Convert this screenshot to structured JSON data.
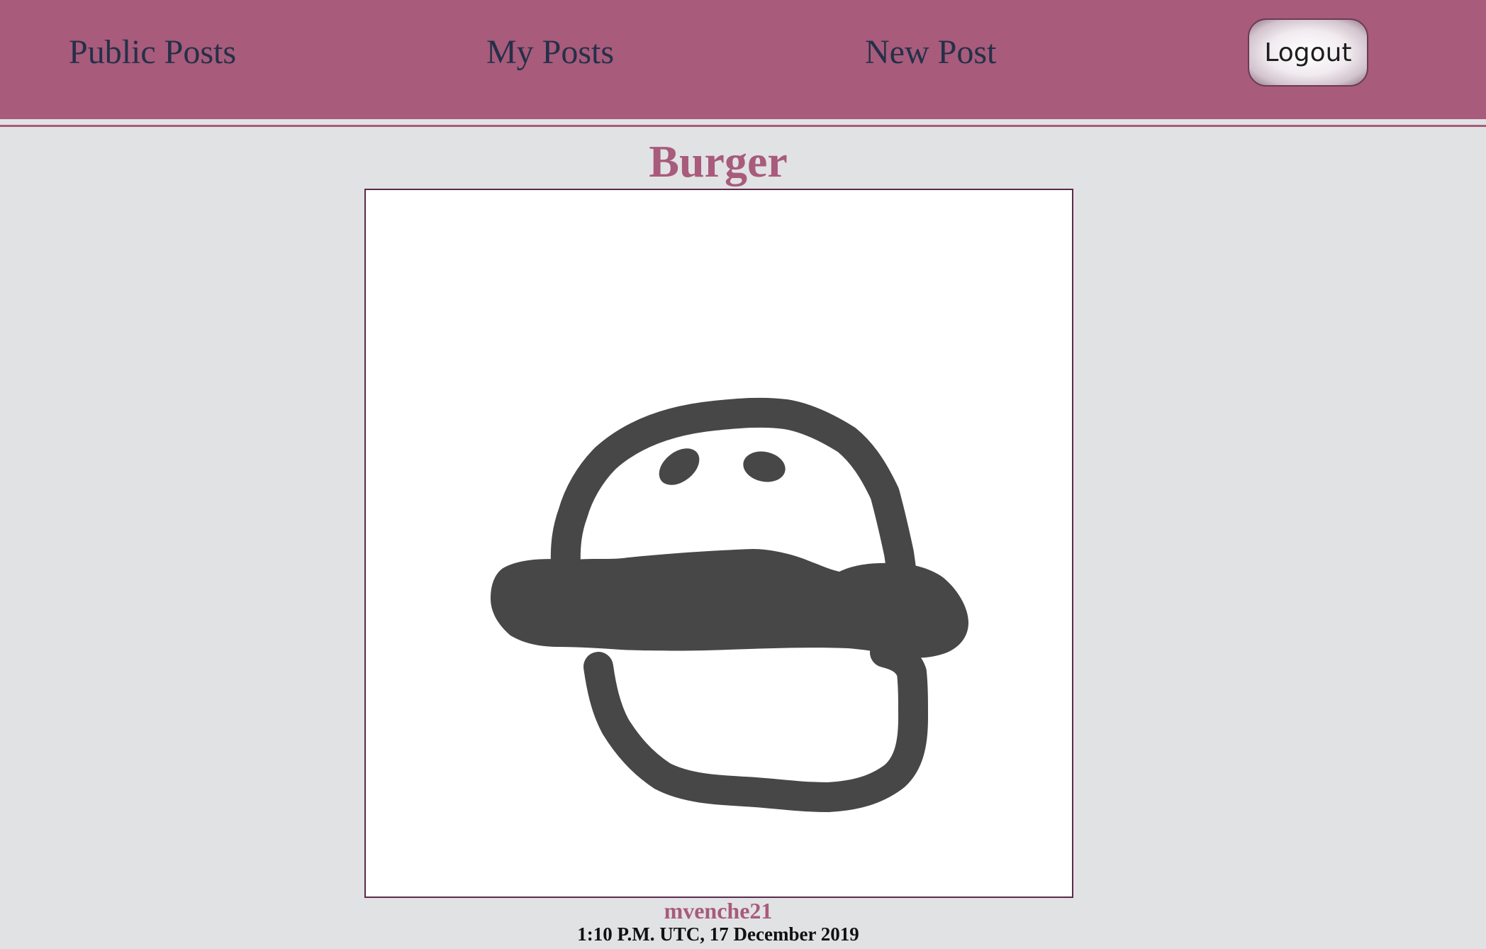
{
  "nav": {
    "public_posts": "Public Posts",
    "my_posts": "My Posts",
    "new_post": "New Post",
    "logout": "Logout"
  },
  "post": {
    "title": "Burger",
    "author": "mvenche21",
    "timestamp": "1:10 P.M. UTC, 17 December 2019",
    "drawing": "burger-drawing"
  },
  "colors": {
    "brand": "#a85b7b",
    "nav_text": "#243049",
    "page_background": "#e1e2e4",
    "canvas_background": "#ffffff",
    "stroke": "#474747"
  }
}
